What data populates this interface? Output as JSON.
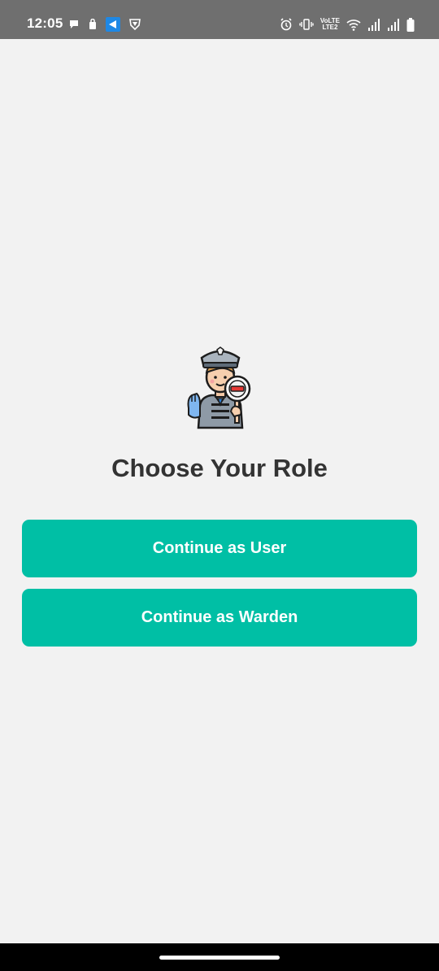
{
  "status_bar": {
    "time": "12:05",
    "left_icons": [
      "chat-icon",
      "sim-icon",
      "messenger-app-icon",
      "vpn-shield-icon"
    ],
    "right_icons": [
      "alarm-icon",
      "vibrate-icon",
      "volte-icon",
      "wifi-icon",
      "signal-1-icon",
      "signal-2-icon",
      "battery-icon"
    ],
    "volte_line1": "VoLTE",
    "volte_line2": "LTE2"
  },
  "role_screen": {
    "illustration": "traffic-warden-icon",
    "title": "Choose Your Role",
    "user_button_label": "Continue as User",
    "warden_button_label": "Continue as Warden"
  },
  "colors": {
    "background": "#f2f2f2",
    "status_bar": "#6f6f6f",
    "accent": "#00bfa5",
    "title_text": "#333333",
    "nav_bar": "#000000"
  }
}
